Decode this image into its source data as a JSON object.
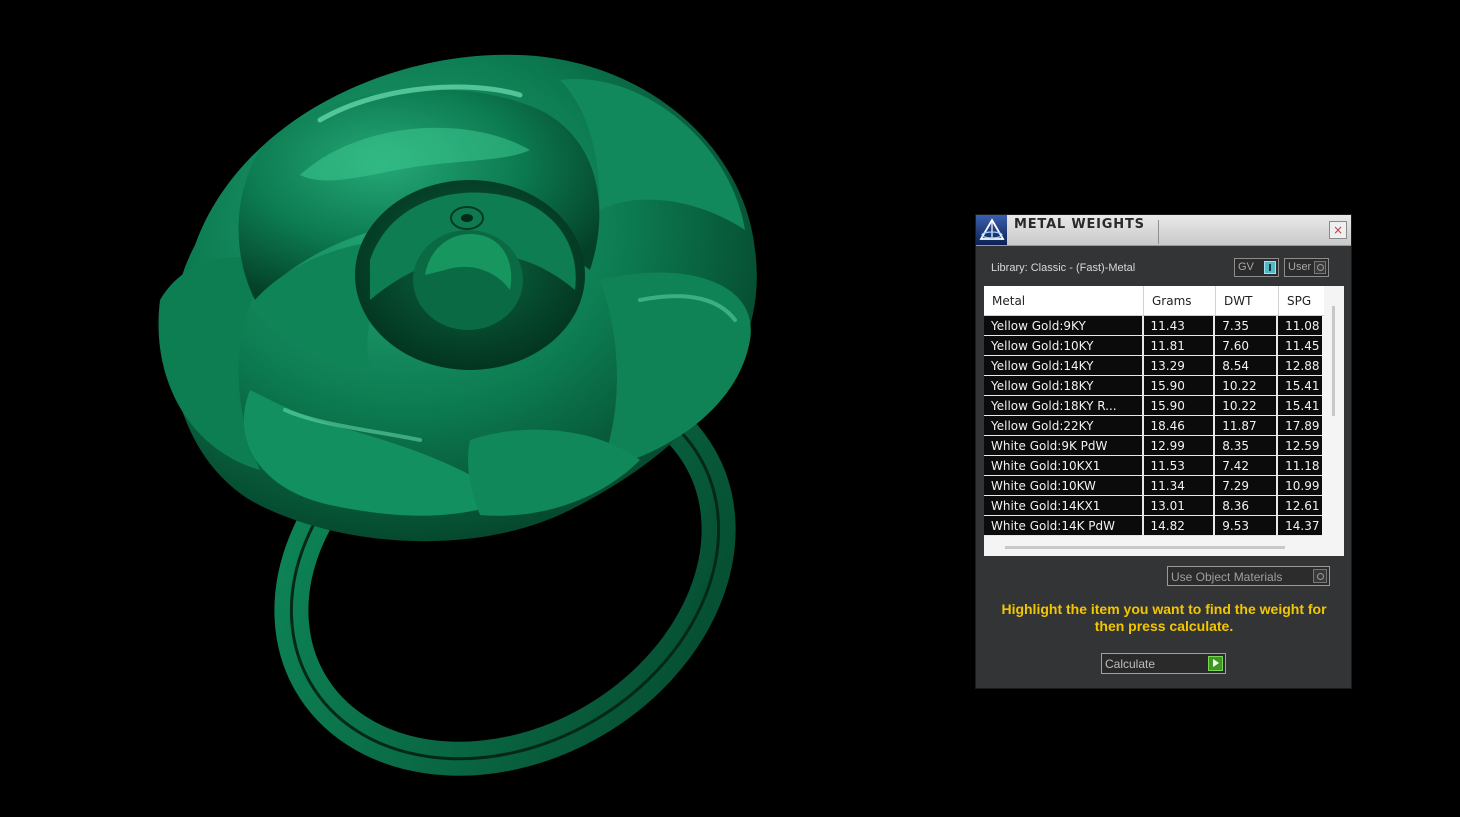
{
  "panel": {
    "title": "METAL WEIGHTS",
    "close_glyph": "×",
    "library_label": "Library: Classic - (Fast)-Metal",
    "toggle_gv": "GV",
    "toggle_user": "User",
    "use_object_materials": "Use Object Materials",
    "hint": "Highlight the item you want to find the weight for then press calculate.",
    "calculate_label": "Calculate"
  },
  "table": {
    "headers": [
      "Metal",
      "Grams",
      "DWT",
      "SPG"
    ],
    "rows": [
      [
        "Yellow Gold:9KY",
        "11.43",
        "7.35",
        "11.08"
      ],
      [
        "Yellow Gold:10KY",
        "11.81",
        "7.60",
        "11.45"
      ],
      [
        "Yellow Gold:14KY",
        "13.29",
        "8.54",
        "12.88"
      ],
      [
        "Yellow Gold:18KY",
        "15.90",
        "10.22",
        "15.41"
      ],
      [
        "Yellow Gold:18KY R...",
        "15.90",
        "10.22",
        "15.41"
      ],
      [
        "Yellow Gold:22KY",
        "18.46",
        "11.87",
        "17.89"
      ],
      [
        "White Gold:9K PdW",
        "12.99",
        "8.35",
        "12.59"
      ],
      [
        "White Gold:10KX1",
        "11.53",
        "7.42",
        "11.18"
      ],
      [
        "White Gold:10KW",
        "11.34",
        "7.29",
        "10.99"
      ],
      [
        "White Gold:14KX1",
        "13.01",
        "8.36",
        "12.61"
      ],
      [
        "White Gold:14K PdW",
        "14.82",
        "9.53",
        "14.37"
      ]
    ]
  },
  "colors": {
    "ring_green": "#0a7a50",
    "hint_yellow": "#f2c700",
    "toggle_active": "#53b8c4",
    "calc_green": "#3c9a1e"
  },
  "icons": {
    "logo": "pyramid-logo-icon",
    "close": "close-icon",
    "calculate": "play-arrow-icon"
  }
}
